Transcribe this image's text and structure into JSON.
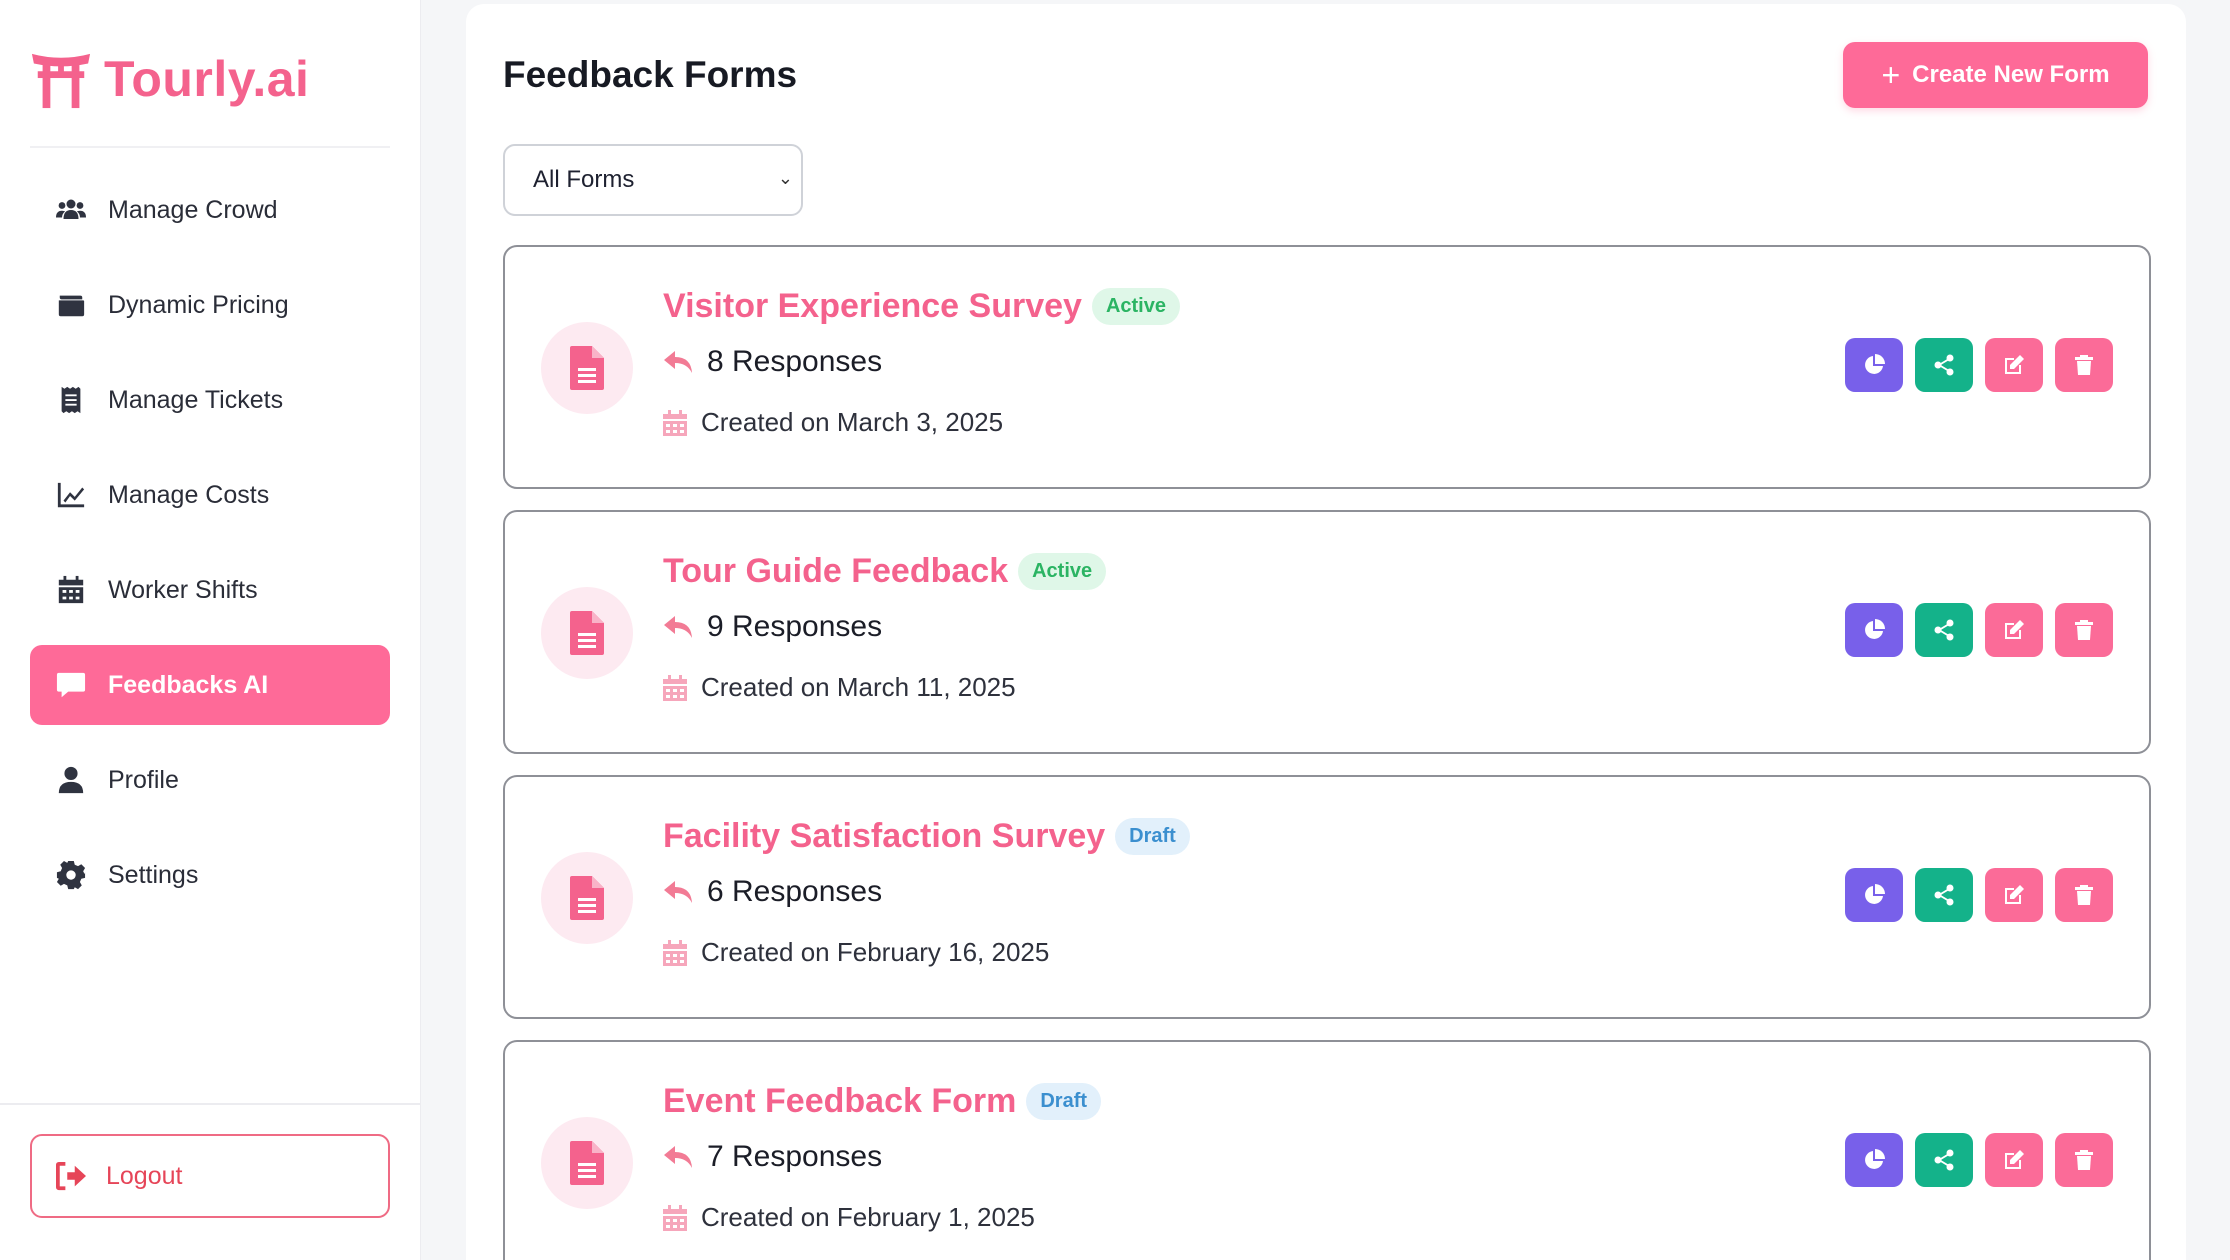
{
  "brand": {
    "name": "Tourly.ai",
    "color": "#f4628d",
    "icon": "torii-gate-icon"
  },
  "sidebar": {
    "items": [
      {
        "label": "Manage Crowd",
        "icon": "users-icon",
        "active": false
      },
      {
        "label": "Dynamic Pricing",
        "icon": "wallet-icon",
        "active": false
      },
      {
        "label": "Manage Tickets",
        "icon": "receipt-icon",
        "active": false
      },
      {
        "label": "Manage Costs",
        "icon": "line-chart-icon",
        "active": false
      },
      {
        "label": "Worker Shifts",
        "icon": "calendar-icon",
        "active": false
      },
      {
        "label": "Feedbacks AI",
        "icon": "comment-icon",
        "active": true
      },
      {
        "label": "Profile",
        "icon": "user-icon",
        "active": false
      },
      {
        "label": "Settings",
        "icon": "gear-icon",
        "active": false
      }
    ],
    "logout_label": "Logout"
  },
  "main": {
    "title": "Feedback Forms",
    "create_button_label": "Create New Form",
    "filter": {
      "selected": "All Forms"
    },
    "forms": [
      {
        "title": "Visitor Experience Survey",
        "status": "Active",
        "responses": "8 Responses",
        "created": "Created on March 3, 2025"
      },
      {
        "title": "Tour Guide Feedback",
        "status": "Active",
        "responses": "9 Responses",
        "created": "Created on March 11, 2025"
      },
      {
        "title": "Facility Satisfaction Survey",
        "status": "Draft",
        "responses": "6 Responses",
        "created": "Created on February 16, 2025"
      },
      {
        "title": "Event Feedback Form",
        "status": "Draft",
        "responses": "7 Responses",
        "created": "Created on February 1, 2025"
      }
    ]
  },
  "colors": {
    "accent": "#fe6a98",
    "analytics_button": "#7860ea",
    "share_button": "#14b28a",
    "active_badge": "#2bb463",
    "draft_badge": "#3b8fcf",
    "logout": "#e64558"
  }
}
